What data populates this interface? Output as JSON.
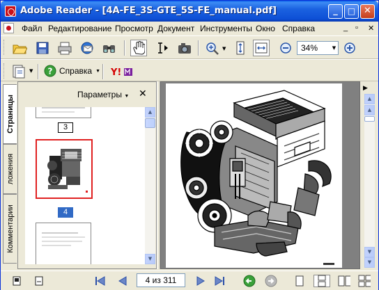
{
  "window": {
    "title": "Adobe Reader - [4A-FE_3S-GTE_5S-FE_manual.pdf]",
    "minimize": "_",
    "maximize": "□",
    "close": "✕"
  },
  "menubar": {
    "items": [
      "Файл",
      "Редактирование",
      "Просмотр",
      "Документ",
      "Инструменты",
      "Окно",
      "Справка"
    ],
    "doc_controls": [
      "_",
      "▫",
      "✕"
    ]
  },
  "toolbar": {
    "zoom_value": "34%",
    "help_label": "Справка",
    "icons": [
      "open-icon",
      "save-icon",
      "print-icon",
      "email-icon",
      "search-icon",
      "hand-icon",
      "select-text-icon",
      "snapshot-icon",
      "zoom-in-icon",
      "fit-height-icon",
      "fit-width-icon",
      "zoom-out-icon",
      "zoom-plus-icon"
    ]
  },
  "navpanel": {
    "tabs": [
      "Страницы",
      "ложения",
      "Комментарии"
    ],
    "options_label": "Параметры",
    "close": "✕",
    "thumbnails": [
      {
        "page": "3",
        "selected": false
      },
      {
        "page": "4",
        "selected": true
      }
    ]
  },
  "statusbar": {
    "page_indicator": "4 из 311"
  },
  "colors": {
    "titlebar": "#0d4fd6",
    "selection": "#316ac5",
    "thumb_highlight": "#e02020",
    "chrome": "#ece9d8"
  }
}
